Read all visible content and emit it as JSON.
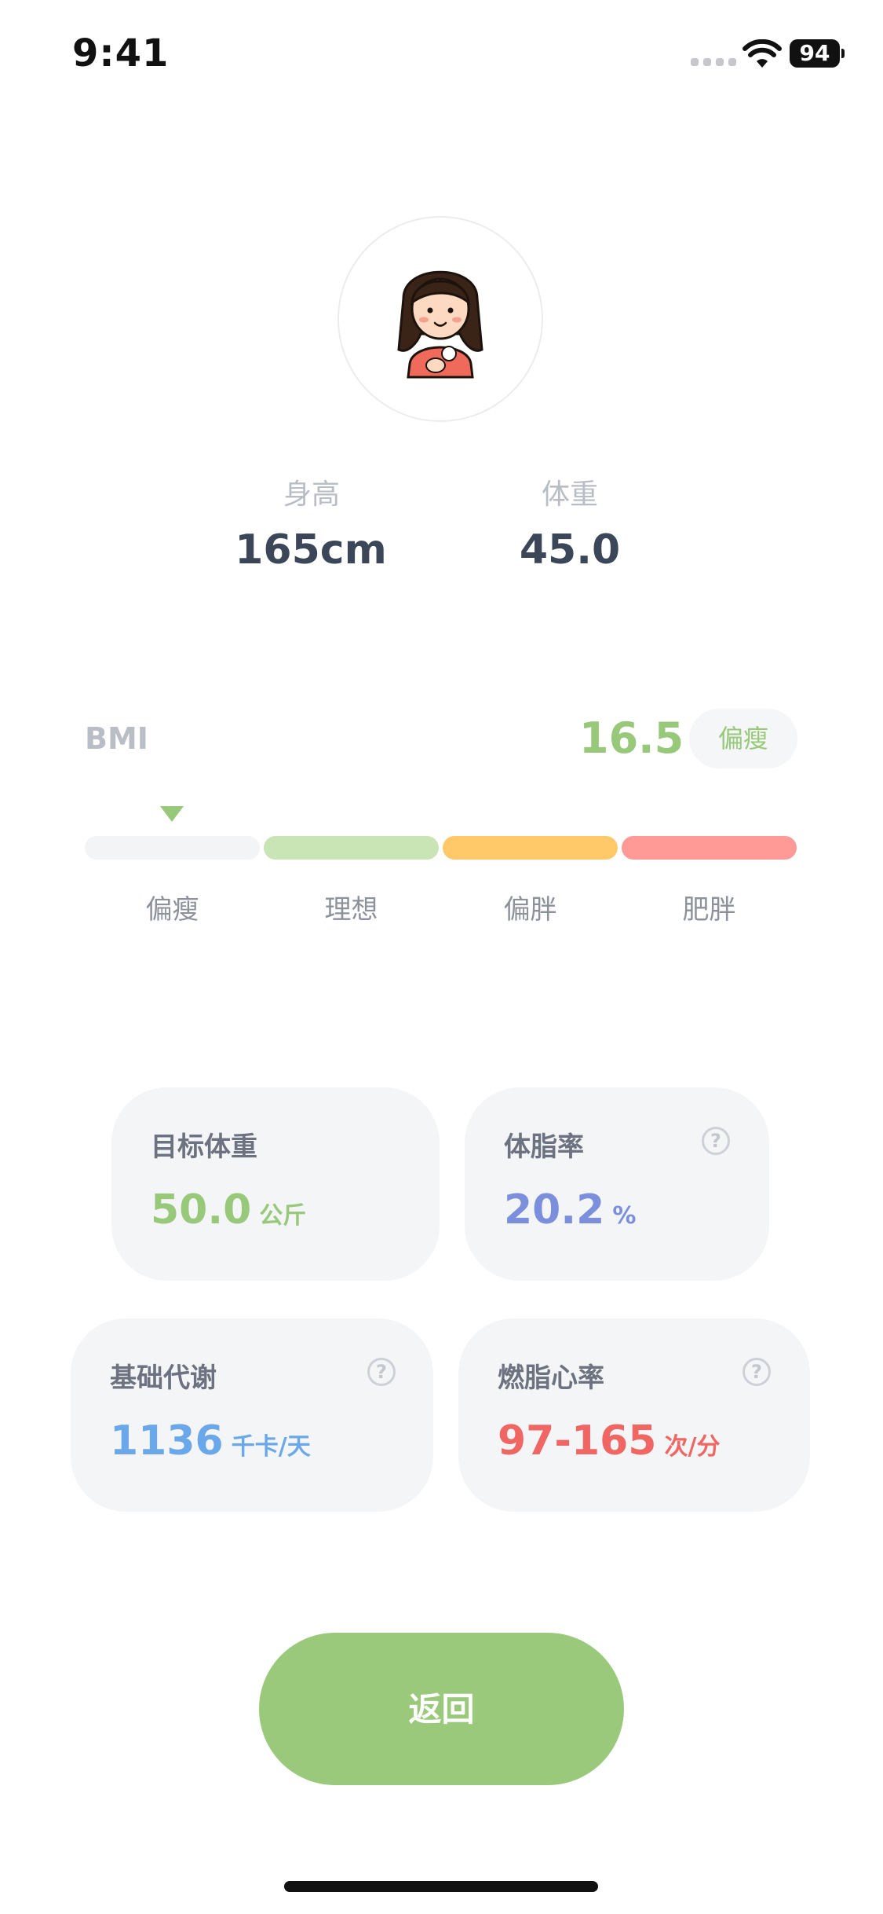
{
  "status_bar": {
    "time": "9:41",
    "battery": "94"
  },
  "profile": {
    "height": {
      "label": "身高",
      "value": "165cm"
    },
    "weight": {
      "label": "体重",
      "value": "45.0"
    }
  },
  "bmi": {
    "label": "BMI",
    "value": "16.5",
    "status": "偏瘦",
    "segments": [
      {
        "label": "偏瘦",
        "color": "#f3f4f6"
      },
      {
        "label": "理想",
        "color": "#c9e4b5"
      },
      {
        "label": "偏胖",
        "color": "#ffc96a"
      },
      {
        "label": "肥胖",
        "color": "#ff9a97"
      }
    ],
    "active_segment": 0
  },
  "cards": {
    "target_weight": {
      "title": "目标体重",
      "value": "50.0",
      "unit": "公斤",
      "color": "#98c879"
    },
    "body_fat": {
      "title": "体脂率",
      "value": "20.2",
      "unit": "%",
      "color": "#7b8fdc"
    },
    "bmr": {
      "title": "基础代谢",
      "value": "1136",
      "unit": "千卡/天",
      "color": "#6aa8ea"
    },
    "fat_burn_hr": {
      "title": "燃脂心率",
      "value": "97-165",
      "unit": "次/分",
      "color": "#ef6663"
    }
  },
  "icons": {
    "help": "?"
  },
  "back_button": {
    "label": "返回",
    "color": "#9bc97c"
  }
}
